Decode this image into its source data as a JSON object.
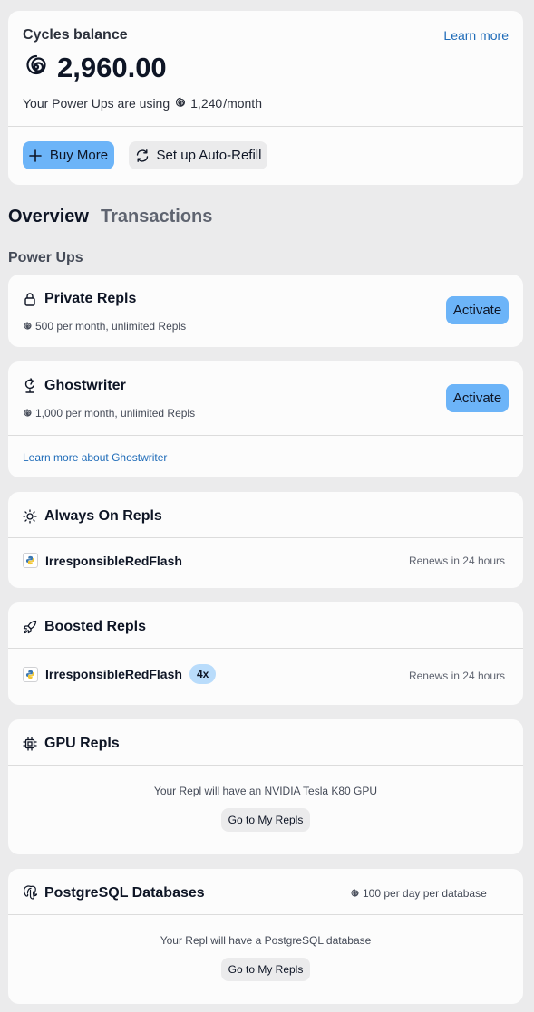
{
  "balance": {
    "label": "Cycles balance",
    "learn_more": "Learn more",
    "amount": "2,960.00",
    "usage_prefix": "Your Power Ups are using",
    "usage_amount": "1,240",
    "usage_suffix": "/month",
    "buy_more": "Buy More",
    "auto_refill": "Set up Auto-Refill"
  },
  "tabs": [
    {
      "label": "Overview",
      "active": true
    },
    {
      "label": "Transactions",
      "active": false
    }
  ],
  "section_title": "Power Ups",
  "private_repls": {
    "title": "Private Repls",
    "price": "500 per month, unlimited Repls",
    "action": "Activate"
  },
  "ghostwriter": {
    "title": "Ghostwriter",
    "price": "1,000 per month, unlimited Repls",
    "action": "Activate",
    "learn_more": "Learn more about Ghostwriter"
  },
  "always_on": {
    "title": "Always On Repls",
    "repl_name": "IrresponsibleRedFlash",
    "renews": "Renews in 24 hours"
  },
  "boosted": {
    "title": "Boosted Repls",
    "repl_name": "IrresponsibleRedFlash",
    "badge": "4x",
    "renews": "Renews in 24 hours"
  },
  "gpu": {
    "title": "GPU Repls",
    "message": "Your Repl will have an NVIDIA Tesla K80 GPU",
    "button": "Go to My Repls"
  },
  "postgres": {
    "title": "PostgreSQL Databases",
    "price": "100 per day per database",
    "message": "Your Repl will have a PostgreSQL database",
    "button": "Go to My Repls"
  },
  "colors": {
    "page_bg": "#ebebec",
    "card_bg": "#fcfcfc",
    "accent_button": "#6cb4f8",
    "link": "#1e6bb8",
    "badge_bg": "#b9dcfb"
  },
  "icons": [
    "cycles-icon",
    "plus-icon",
    "refresh-icon",
    "lock-icon",
    "ghostwriter-icon",
    "sun-icon",
    "python-icon",
    "rocket-icon",
    "chip-icon",
    "postgres-icon"
  ]
}
